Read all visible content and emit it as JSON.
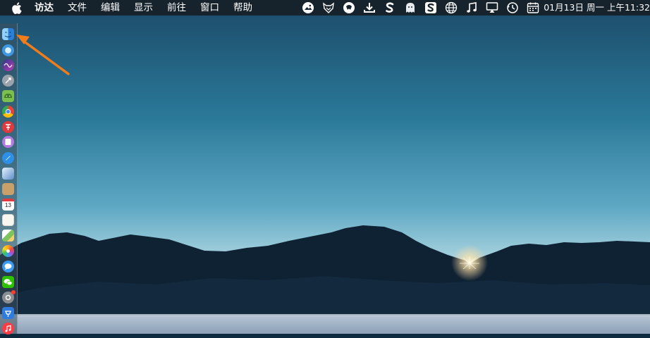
{
  "menubar": {
    "app_name": "访达",
    "items": [
      "文件",
      "编辑",
      "显示",
      "前往",
      "窗口",
      "帮助"
    ],
    "clock": "01月13日 周一 上午11:32"
  },
  "status_icons": [
    "photo-icon",
    "fox-icon",
    "browser-icon",
    "download-icon",
    "s-app-icon",
    "ghost-icon",
    "sogou-icon",
    "globe-icon",
    "music-note-icon",
    "airplay-icon",
    "time-machine-icon",
    "calendar-icon"
  ],
  "dock": {
    "items": [
      {
        "name": "finder",
        "color": "#3b8fe0"
      },
      {
        "name": "safari",
        "color": "#4aa3e8"
      },
      {
        "name": "siri",
        "color": "#7b4fd6"
      },
      {
        "name": "launchpad",
        "color": "#a0a8b0"
      },
      {
        "name": "android-studio",
        "color": "#6ab04c"
      },
      {
        "name": "chrome",
        "color": "#e94235"
      },
      {
        "name": "app-red",
        "color": "#e0393e"
      },
      {
        "name": "app-purple",
        "color": "#a566d8"
      },
      {
        "name": "safari-compass",
        "color": "#2e8fe6"
      },
      {
        "name": "preview",
        "color": "#5c8fc9"
      },
      {
        "name": "notes-brown",
        "color": "#b58c5a"
      },
      {
        "name": "calendar",
        "color": "#ffffff"
      },
      {
        "name": "notes",
        "color": "#f3f3ee"
      },
      {
        "name": "maps",
        "color": "#7fc35e"
      },
      {
        "name": "photos",
        "color": "#f5a623"
      },
      {
        "name": "messages",
        "color": "#3c9bf0"
      },
      {
        "name": "wechat",
        "color": "#2dc100"
      },
      {
        "name": "system-preferences",
        "color": "#8a8d91"
      },
      {
        "name": "keynote",
        "color": "#2f7be0"
      },
      {
        "name": "music",
        "color": "#fc3c44"
      }
    ],
    "calendar_day": "13"
  }
}
